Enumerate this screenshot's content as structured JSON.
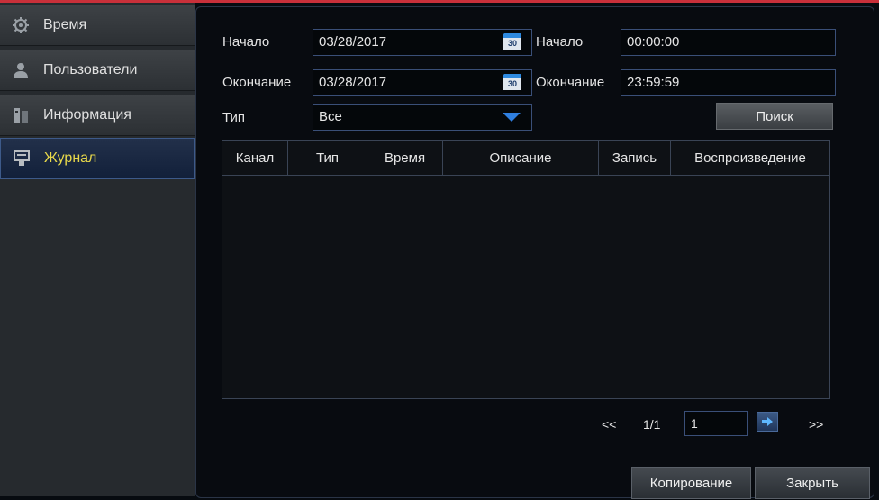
{
  "sidebar": {
    "items": [
      {
        "label": "Время",
        "icon": "gear-icon"
      },
      {
        "label": "Пользователи",
        "icon": "user-icon"
      },
      {
        "label": "Информация",
        "icon": "info-icon"
      },
      {
        "label": "Журнал",
        "icon": "log-icon",
        "active": true
      }
    ]
  },
  "filters": {
    "start_date_label": "Начало",
    "start_date_value": "03/28/2017",
    "start_time_label": "Начало",
    "start_time_value": "00:00:00",
    "end_date_label": "Окончание",
    "end_date_value": "03/28/2017",
    "end_time_label": "Окончание",
    "end_time_value": "23:59:59",
    "calendar_day": "30",
    "type_label": "Тип",
    "type_value": "Все",
    "search_label": "Поиск"
  },
  "table": {
    "columns": [
      "Канал",
      "Тип",
      "Время",
      "Описание",
      "Запись",
      "Воспроизведение"
    ],
    "rows": []
  },
  "pagination": {
    "first": "<<",
    "page_info": "1/1",
    "page_input": "1",
    "last": ">>"
  },
  "footer": {
    "copy_label": "Копирование",
    "close_label": "Закрыть"
  },
  "colors": {
    "accent_active_text": "#e7d84a",
    "field_border": "#3a4f78",
    "top_bar": "#c9303a"
  }
}
